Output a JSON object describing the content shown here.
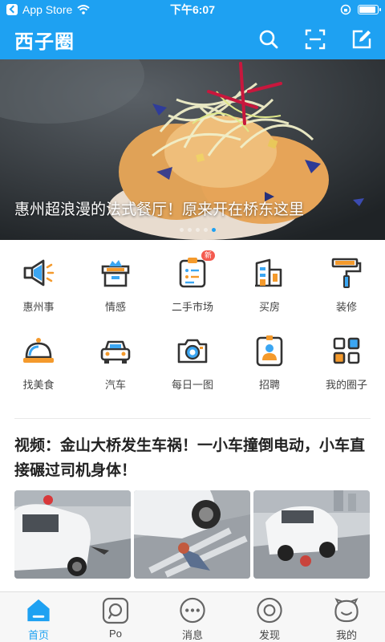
{
  "status_bar": {
    "back_label": "App Store",
    "time": "下午6:07"
  },
  "header": {
    "logo": "西子圈",
    "icons": [
      "search-icon",
      "scan-icon",
      "edit-icon"
    ]
  },
  "banner": {
    "title": "惠州超浪漫的法式餐厅！原来开在桥东这里",
    "dots": 5,
    "active_dot": 5
  },
  "categories": [
    {
      "label": "惠州事",
      "icon": "megaphone-icon"
    },
    {
      "label": "情感",
      "icon": "box-icon"
    },
    {
      "label": "二手市场",
      "icon": "market-icon",
      "badge": "新"
    },
    {
      "label": "买房",
      "icon": "building-icon"
    },
    {
      "label": "装修",
      "icon": "paint-roller-icon"
    },
    {
      "label": "找美食",
      "icon": "food-cloche-icon"
    },
    {
      "label": "汽车",
      "icon": "car-icon"
    },
    {
      "label": "每日一图",
      "icon": "camera-icon"
    },
    {
      "label": "招聘",
      "icon": "id-badge-icon"
    },
    {
      "label": "我的圈子",
      "icon": "grid-icon"
    }
  ],
  "article": {
    "title": "视频：金山大桥发生车祸！一小车撞倒电动，小车直接碾过司机身体！"
  },
  "tabbar": [
    {
      "label": "首页",
      "icon": "home-icon",
      "active": true
    },
    {
      "label": "Po",
      "icon": "post-icon",
      "active": false
    },
    {
      "label": "消息",
      "icon": "message-icon",
      "active": false
    },
    {
      "label": "发现",
      "icon": "discover-icon",
      "active": false
    },
    {
      "label": "我的",
      "icon": "profile-icon",
      "active": false
    }
  ],
  "colors": {
    "brand": "#1ea1f2",
    "badge": "#f45a4f",
    "icon_orange": "#f49a2c",
    "icon_blue": "#3ba6f2"
  }
}
